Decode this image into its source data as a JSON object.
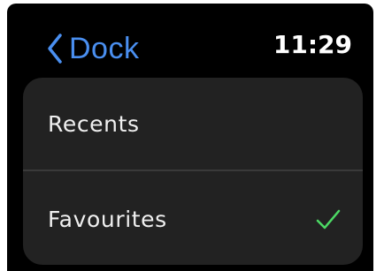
{
  "header": {
    "back_label": "Dock",
    "time": "11:29"
  },
  "list": {
    "items": [
      {
        "label": "Recents",
        "selected": false
      },
      {
        "label": "Favourites",
        "selected": true
      }
    ]
  },
  "colors": {
    "accent_blue": "#4a8ff0",
    "check_green": "#4cd964",
    "card_background": "#222222",
    "screen_background": "#000000"
  },
  "icons": {
    "back": "chevron-left-icon",
    "selected": "checkmark-icon"
  }
}
